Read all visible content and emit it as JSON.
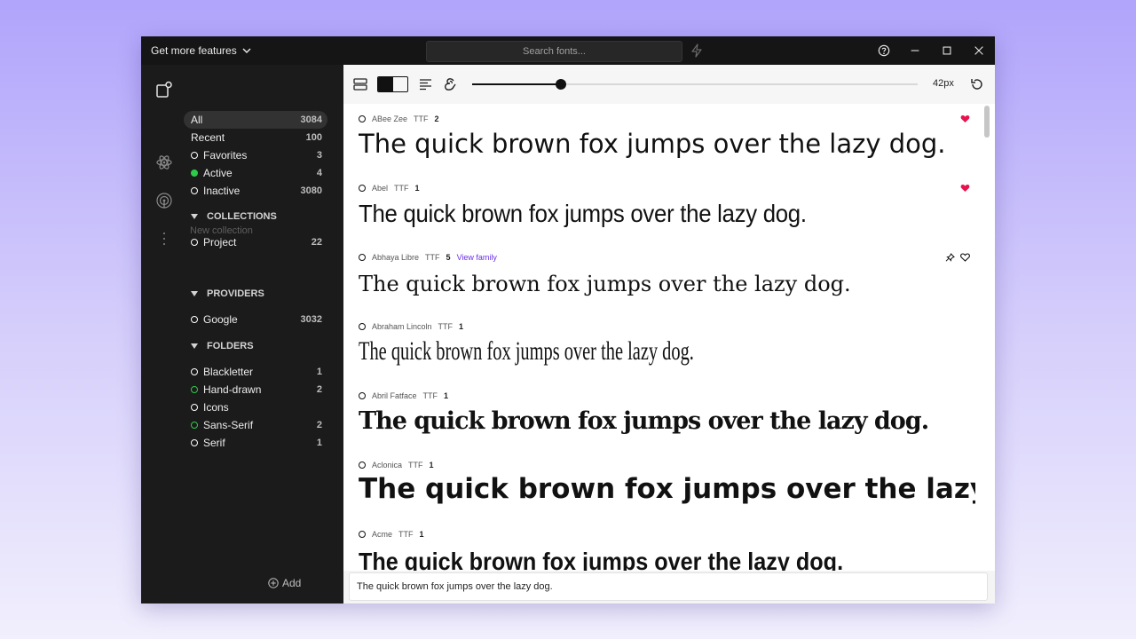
{
  "titlebar": {
    "features_label": "Get more features",
    "search_placeholder": "Search fonts..."
  },
  "sidebar": {
    "filters": [
      {
        "label": "All",
        "count": "3084",
        "dot": "none"
      },
      {
        "label": "Recent",
        "count": "100",
        "dot": "none"
      },
      {
        "label": "Favorites",
        "count": "3",
        "dot": "white"
      },
      {
        "label": "Active",
        "count": "4",
        "dot": "green-filled"
      },
      {
        "label": "Inactive",
        "count": "3080",
        "dot": "white"
      }
    ],
    "collections_heading": "COLLECTIONS",
    "collections": [
      {
        "label": "Project",
        "count": "22"
      }
    ],
    "new_collection": "New collection",
    "providers_heading": "PROVIDERS",
    "providers": [
      {
        "label": "Google",
        "count": "3032"
      }
    ],
    "folders_heading": "FOLDERS",
    "folders": [
      {
        "label": "Blackletter",
        "count": "1",
        "dot": "white"
      },
      {
        "label": "Hand-drawn",
        "count": "2",
        "dot": "green"
      },
      {
        "label": "Icons",
        "count": "",
        "dot": "white"
      },
      {
        "label": "Sans-Serif",
        "count": "2",
        "dot": "green"
      },
      {
        "label": "Serif",
        "count": "1",
        "dot": "white"
      }
    ],
    "add_label": "Add"
  },
  "toolbar": {
    "size_label": "42px",
    "size_fraction": 0.2
  },
  "fonts": [
    {
      "name": "ABee Zee",
      "format": "TTF",
      "styles": "2",
      "family_link": "",
      "favorite": true,
      "sample": "The quick brown fox jumps over the lazy dog."
    },
    {
      "name": "Abel",
      "format": "TTF",
      "styles": "1",
      "family_link": "",
      "favorite": true,
      "sample": "The quick brown fox jumps over the lazy dog."
    },
    {
      "name": "Abhaya Libre",
      "format": "TTF",
      "styles": "5",
      "family_link": "View family",
      "favorite": false,
      "sample": "The quick brown fox jumps over the lazy dog."
    },
    {
      "name": "Abraham Lincoln",
      "format": "TTF",
      "styles": "1",
      "family_link": "",
      "favorite": false,
      "sample": "The quick brown fox jumps over the lazy dog."
    },
    {
      "name": "Abril Fatface",
      "format": "TTF",
      "styles": "1",
      "family_link": "",
      "favorite": false,
      "sample": "The quick brown fox jumps over the lazy dog."
    },
    {
      "name": "Aclonica",
      "format": "TTF",
      "styles": "1",
      "family_link": "",
      "favorite": false,
      "sample": "The quick brown fox jumps over the lazy dog."
    },
    {
      "name": "Acme",
      "format": "TTF",
      "styles": "1",
      "family_link": "",
      "favorite": false,
      "sample": "The quick brown fox jumps over the lazy dog."
    }
  ],
  "sample_text": "The quick brown fox jumps over the lazy dog.",
  "colors": {
    "accent": "#6a2ee8",
    "favorite": "#e8134e",
    "active": "#2dcc48"
  }
}
